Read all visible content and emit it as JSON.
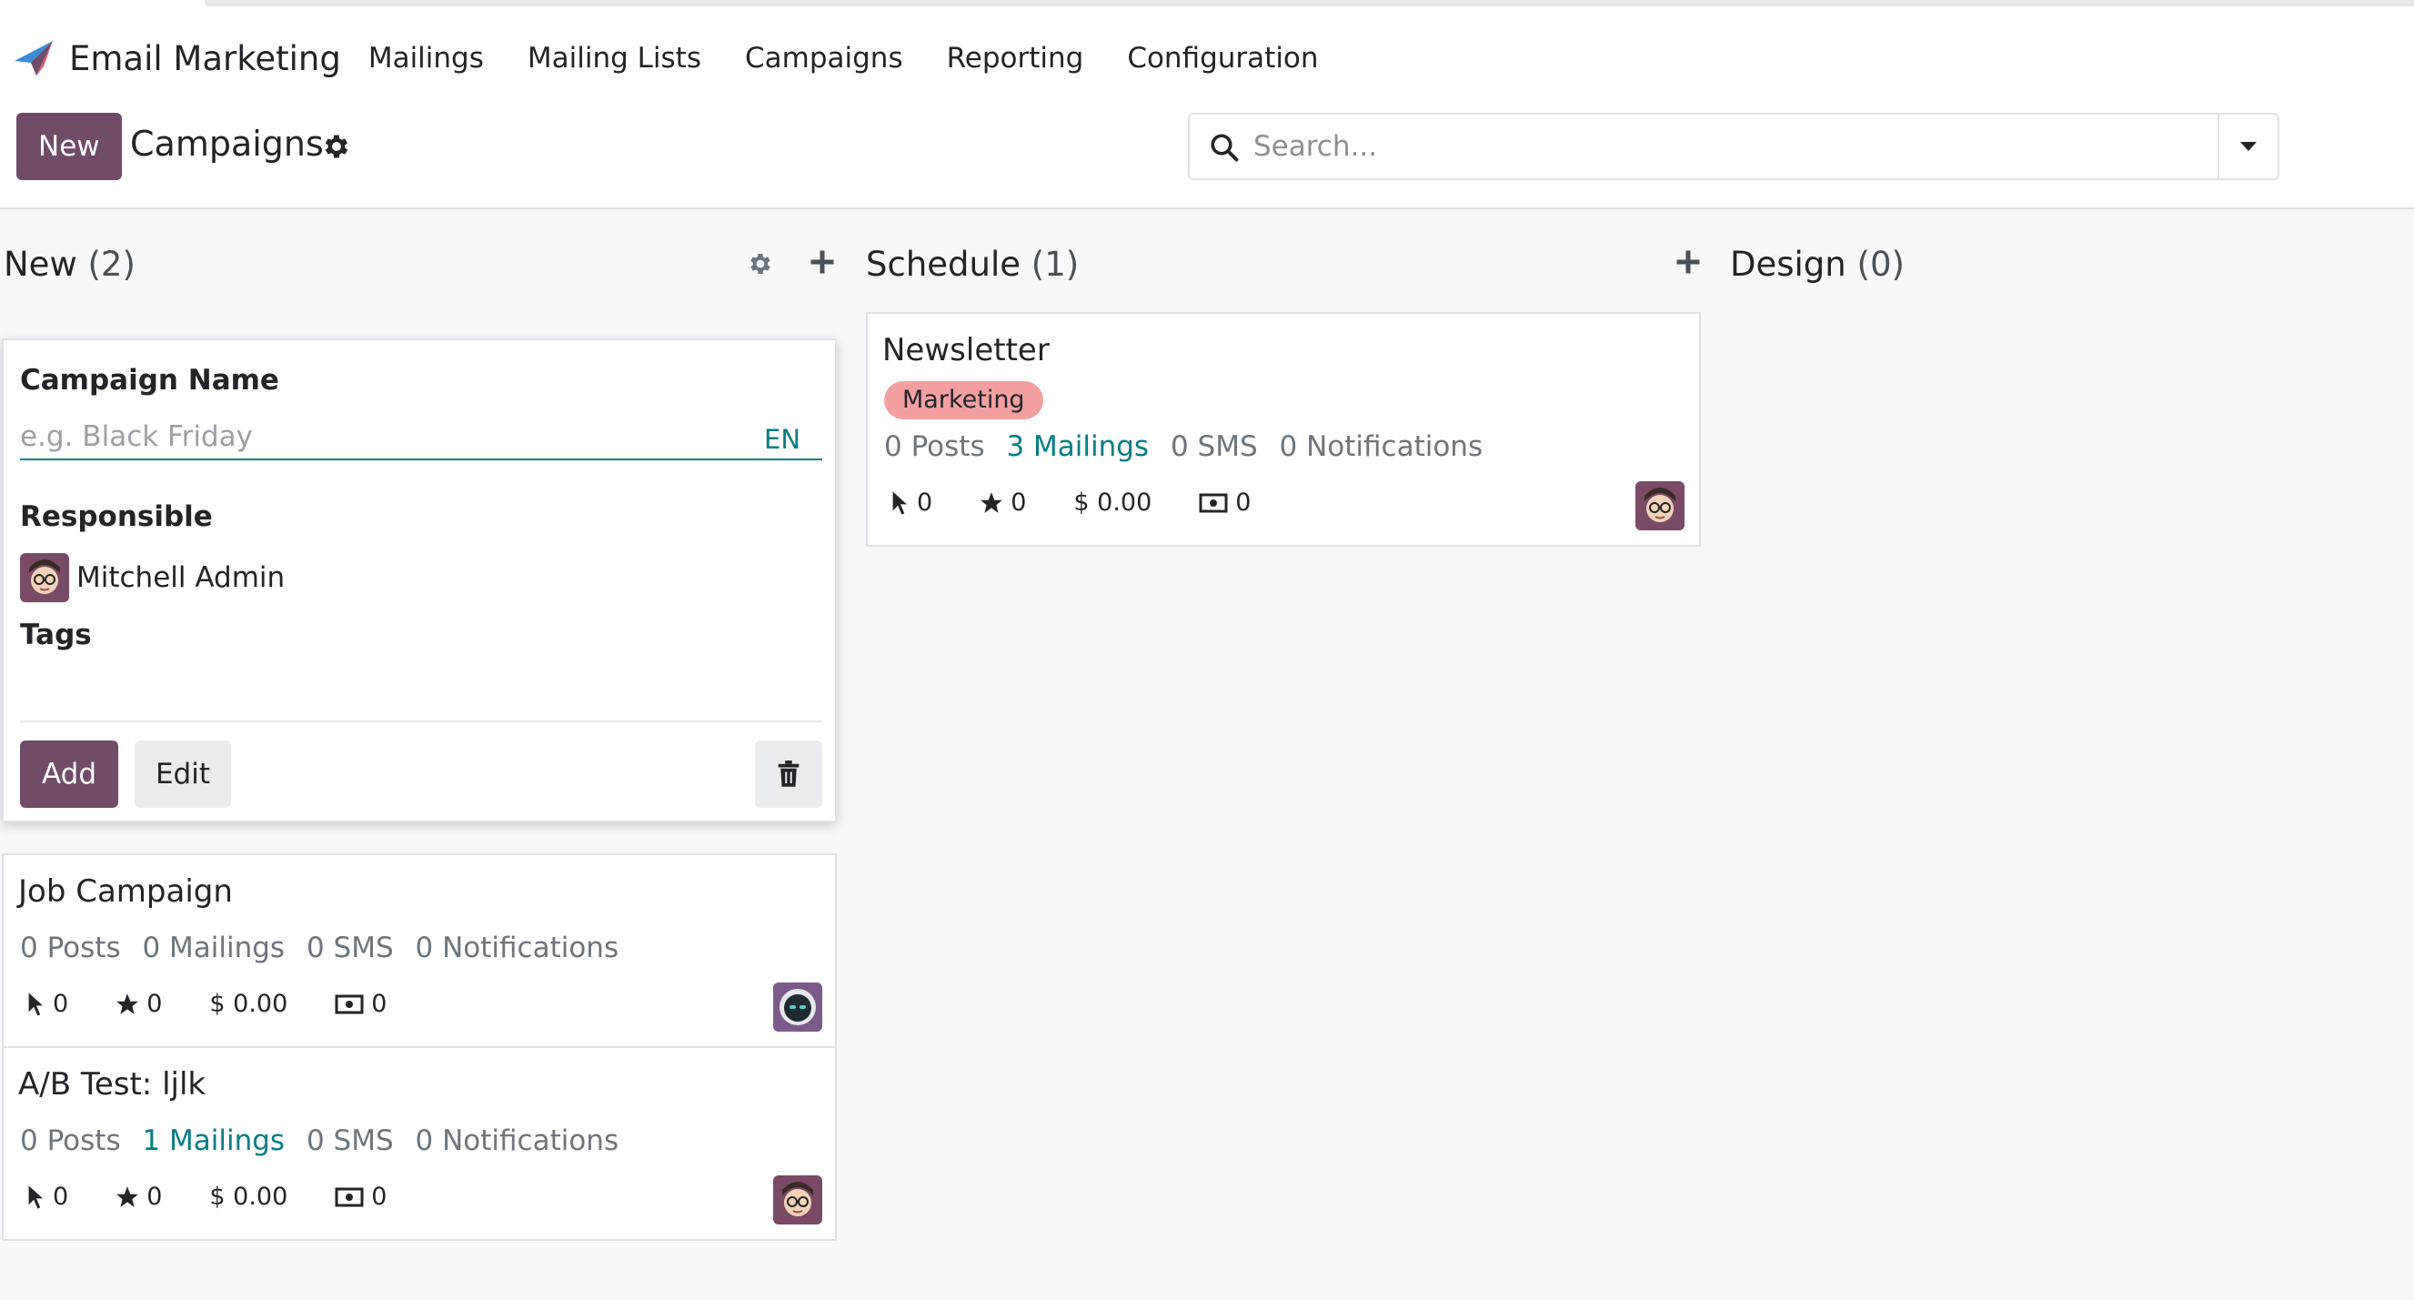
{
  "app": {
    "title": "Email Marketing"
  },
  "menu": [
    "Mailings",
    "Mailing Lists",
    "Campaigns",
    "Reporting",
    "Configuration"
  ],
  "control": {
    "new_label": "New",
    "page_title": "Campaigns",
    "search_placeholder": "Search..."
  },
  "columns": [
    {
      "title": "New",
      "count": "(2)"
    },
    {
      "title": "Schedule",
      "count": "(1)"
    },
    {
      "title": "Design",
      "count": "(0)"
    }
  ],
  "quick_create": {
    "name_label": "Campaign Name",
    "name_placeholder": "e.g. Black Friday",
    "lang": "EN",
    "responsible_label": "Responsible",
    "responsible_value": "Mitchell Admin",
    "tags_label": "Tags",
    "add_label": "Add",
    "edit_label": "Edit"
  },
  "cards": {
    "job": {
      "title": "Job Campaign",
      "posts": "0 Posts",
      "mailings": "0 Mailings",
      "sms": "0 SMS",
      "notifications": "0 Notifications",
      "clicks": "0",
      "stars": "0",
      "revenue": "$ 0.00",
      "money": "0"
    },
    "ab": {
      "title": "A/B Test: ljlk",
      "posts": "0 Posts",
      "mailings": "1 Mailings",
      "sms": "0 SMS",
      "notifications": "0 Notifications",
      "clicks": "0",
      "stars": "0",
      "revenue": "$ 0.00",
      "money": "0"
    },
    "newsletter": {
      "title": "Newsletter",
      "tag": "Marketing",
      "posts": "0 Posts",
      "mailings": "3 Mailings",
      "sms": "0 SMS",
      "notifications": "0 Notifications",
      "clicks": "0",
      "stars": "0",
      "revenue": "$ 0.00",
      "money": "0"
    }
  },
  "colors": {
    "primary": "#714b67",
    "link": "#017e84",
    "tag": "#f4a0a0"
  }
}
